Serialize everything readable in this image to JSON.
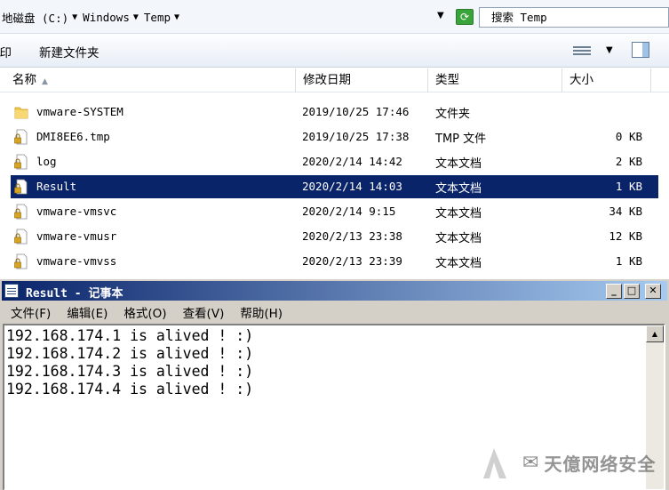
{
  "explorer": {
    "breadcrumbs": [
      "地磁盘 (C:)",
      "Windows",
      "Temp"
    ],
    "search_placeholder": "搜索 Temp",
    "toolbar": {
      "print_label": "打印",
      "new_folder_label": "新建文件夹"
    },
    "columns": {
      "name": "名称",
      "date": "修改日期",
      "type": "类型",
      "size": "大小"
    },
    "files": [
      {
        "name": "vmware-SYSTEM",
        "date": "2019/10/25 17:46",
        "type": "文件夹",
        "size": "",
        "icon": "folder-icon"
      },
      {
        "name": "DMI8EE6.tmp",
        "date": "2019/10/25 17:38",
        "type": "TMP 文件",
        "size": "0 KB",
        "icon": "file-locked-icon"
      },
      {
        "name": "log",
        "date": "2020/2/14 14:42",
        "type": "文本文档",
        "size": "2 KB",
        "icon": "file-locked-icon"
      },
      {
        "name": "Result",
        "date": "2020/2/14 14:03",
        "type": "文本文档",
        "size": "1 KB",
        "icon": "file-locked-icon",
        "selected": true
      },
      {
        "name": "vmware-vmsvc",
        "date": "2020/2/14 9:15",
        "type": "文本文档",
        "size": "34 KB",
        "icon": "file-locked-icon"
      },
      {
        "name": "vmware-vmusr",
        "date": "2020/2/13 23:38",
        "type": "文本文档",
        "size": "12 KB",
        "icon": "file-locked-icon"
      },
      {
        "name": "vmware-vmvss",
        "date": "2020/2/13 23:39",
        "type": "文本文档",
        "size": "1 KB",
        "icon": "file-locked-icon"
      }
    ]
  },
  "notepad": {
    "title": "Result - 记事本",
    "menu": [
      "文件(F)",
      "编辑(E)",
      "格式(O)",
      "查看(V)",
      "帮助(H)"
    ],
    "content_lines": [
      "192.168.174.1 is alived ! :)",
      "192.168.174.2 is alived ! :)",
      "192.168.174.3 is alived ! :)",
      "192.168.174.4 is alived ! :)"
    ]
  },
  "watermark": {
    "text": "天億网络安全"
  },
  "colors": {
    "selection": "#0a246a",
    "title_bar_start": "#0a246a",
    "title_bar_end": "#a6caf0",
    "window_face": "#d4d0c8"
  }
}
